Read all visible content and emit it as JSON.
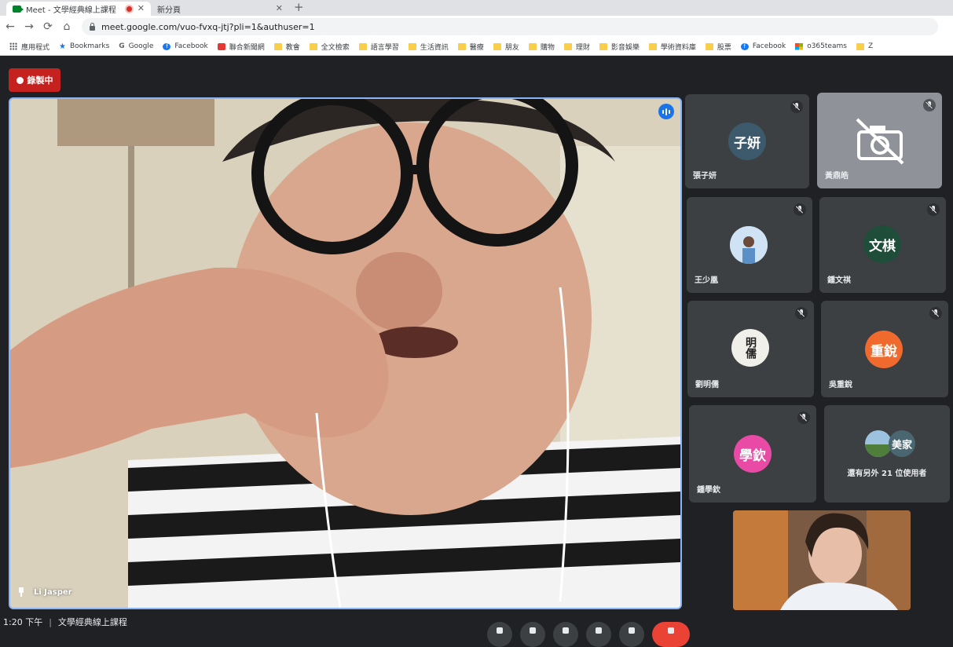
{
  "browser": {
    "tabs": [
      {
        "title": "Meet - 文學經典線上課程",
        "active": true
      },
      {
        "title": "新分頁",
        "active": false
      }
    ],
    "new_tab": "+",
    "url": "meet.google.com/vuo-fvxq-jtj?pli=1&authuser=1",
    "nav": {
      "back": "←",
      "forward": "→",
      "reload": "⟳",
      "home": "⌂"
    },
    "bookmarks": [
      {
        "label": "應用程式",
        "icon": "apps-icon"
      },
      {
        "label": "Bookmarks",
        "icon": "star-icon"
      },
      {
        "label": "Google",
        "icon": "google-icon"
      },
      {
        "label": "Facebook",
        "icon": "facebook-icon"
      },
      {
        "label": "聯合新聞網",
        "icon": "news-icon"
      },
      {
        "label": "教會",
        "icon": "folder-icon"
      },
      {
        "label": "全文檢索",
        "icon": "folder-icon"
      },
      {
        "label": "語言學習",
        "icon": "folder-icon"
      },
      {
        "label": "生活資訊",
        "icon": "folder-icon"
      },
      {
        "label": "醫療",
        "icon": "folder-icon"
      },
      {
        "label": "朋友",
        "icon": "folder-icon"
      },
      {
        "label": "購物",
        "icon": "folder-icon"
      },
      {
        "label": "理財",
        "icon": "folder-icon"
      },
      {
        "label": "影音娛樂",
        "icon": "folder-icon"
      },
      {
        "label": "學術資料庫",
        "icon": "folder-icon"
      },
      {
        "label": "股票",
        "icon": "folder-icon"
      },
      {
        "label": "Facebook",
        "icon": "facebook-icon"
      },
      {
        "label": "o365teams",
        "icon": "microsoft-icon"
      },
      {
        "label": "Z",
        "icon": "folder-icon"
      }
    ]
  },
  "meet": {
    "recording_label": "錄製中",
    "main_speaker": "Li Jasper",
    "participants": [
      {
        "name": "張子妍",
        "initials": "子妍",
        "color": "#3d5a6c",
        "type": "initials"
      },
      {
        "name": "黃鼎皓",
        "initials": "",
        "color": "#9aa0a6",
        "type": "camera-off"
      },
      {
        "name": "王少凰",
        "initials": "",
        "color": "#a7c7e7",
        "type": "photo"
      },
      {
        "name": "鍾文祺",
        "initials": "文棋",
        "color": "#1e4d3a",
        "type": "initials"
      },
      {
        "name": "劉明儒",
        "initials": "明儒",
        "color": "#f1efe9",
        "type": "calligraphy"
      },
      {
        "name": "吳重銳",
        "initials": "重銳",
        "color": "#f06a2e",
        "type": "initials"
      },
      {
        "name": "鍾學欽",
        "initials": "學欽",
        "color": "#e84aa6",
        "type": "initials"
      }
    ],
    "others": {
      "avatar_label": "美家",
      "avatar_color": "#4a6670",
      "text": "還有另外 21 位使用者"
    },
    "bottom": {
      "time": "1:20 下午",
      "separator": "|",
      "meeting_name": "文學經典線上課程"
    }
  }
}
